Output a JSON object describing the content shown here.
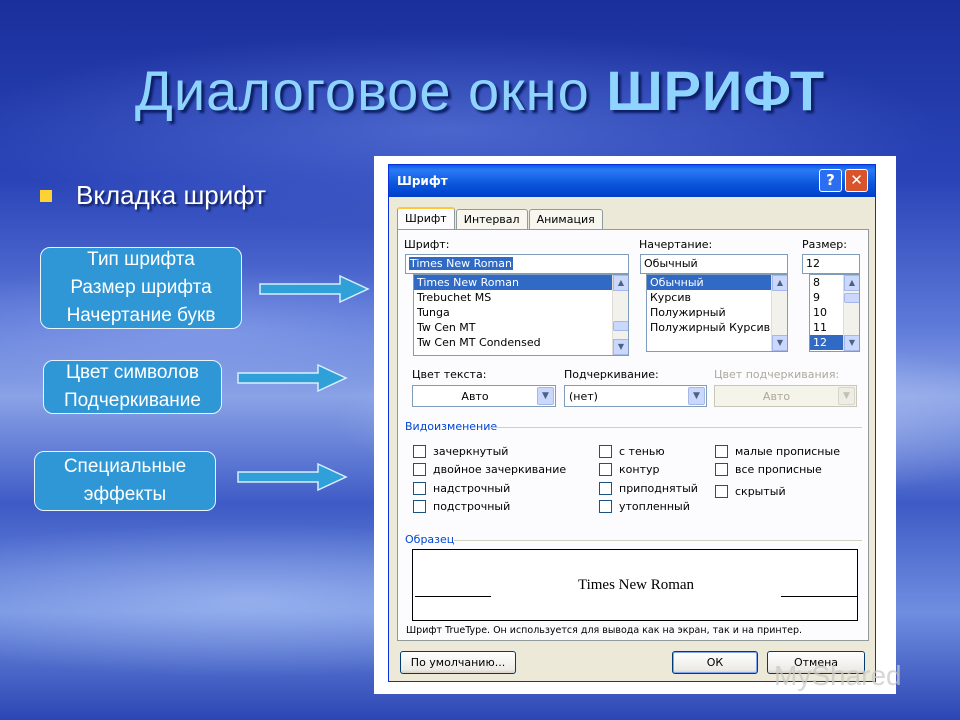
{
  "slide": {
    "title_part1": "Диалоговое окно ",
    "title_part2": "ШРИФТ",
    "bullet": "Вкладка шрифт",
    "callouts": [
      {
        "lines": [
          "Тип шрифта",
          "Размер шрифта",
          "Начертание букв"
        ]
      },
      {
        "lines": [
          "Цвет символов",
          "Подчеркивание"
        ]
      },
      {
        "lines": [
          "Специальные",
          "эффекты"
        ]
      }
    ],
    "colors": {
      "title": "#8fd4ff",
      "callout": "#2f97d6",
      "bullet_marker": "#ffd233"
    }
  },
  "dialog": {
    "title": "Шрифт",
    "help_btn": "?",
    "close_btn": "✕",
    "tabs": [
      "Шрифт",
      "Интервал",
      "Анимация"
    ],
    "font_label": "Шрифт:",
    "font_value": "Times New Roman",
    "font_list": [
      "Times New Roman",
      "Trebuchet MS",
      "Tunga",
      "Tw Cen MT",
      "Tw Cen MT Condensed"
    ],
    "style_label": "Начертание:",
    "style_value": "Обычный",
    "style_list": [
      "Обычный",
      "Курсив",
      "Полужирный",
      "Полужирный Курсив"
    ],
    "size_label": "Размер:",
    "size_value": "12",
    "size_list": [
      "8",
      "9",
      "10",
      "11",
      "12"
    ],
    "color_label": "Цвет текста:",
    "color_value": "Авто",
    "underline_label": "Подчеркивание:",
    "underline_value": "(нет)",
    "underline_color_label": "Цвет подчеркивания:",
    "underline_color_value": "Авто",
    "effects_label": "Видоизменение",
    "effects": [
      [
        "зачеркнутый",
        "двойное зачеркивание",
        "надстрочный",
        "подстрочный"
      ],
      [
        "с тенью",
        "контур",
        "приподнятый",
        "утопленный"
      ],
      [
        "малые прописные",
        "все прописные",
        "скрытый"
      ]
    ],
    "preview_label": "Образец",
    "preview_text": "Times New Roman",
    "preview_note": "Шрифт TrueType. Он используется для вывода как на экран, так и на принтер.",
    "default_btn": "По умолчанию...",
    "ok_btn": "ОК",
    "cancel_btn": "Отмена"
  },
  "watermark": "MyShared"
}
